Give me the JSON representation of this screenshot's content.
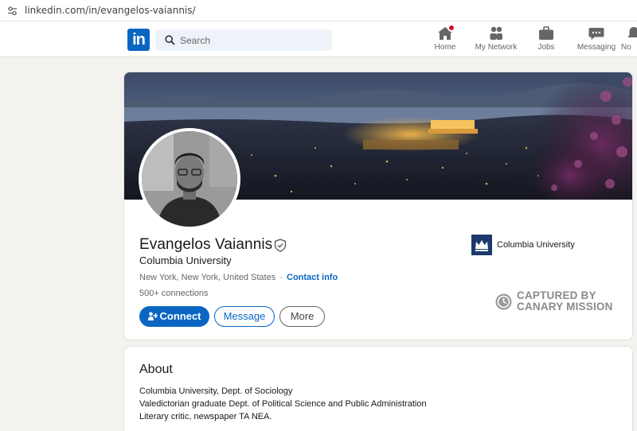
{
  "browser": {
    "url": "linkedin.com/in/evangelos-vaiannis/"
  },
  "nav": {
    "logo": "in",
    "search_placeholder": "Search",
    "items": [
      {
        "label": "Home",
        "icon": "home-icon"
      },
      {
        "label": "My Network",
        "icon": "network-icon"
      },
      {
        "label": "Jobs",
        "icon": "briefcase-icon"
      },
      {
        "label": "Messaging",
        "icon": "messaging-icon"
      },
      {
        "label": "No",
        "icon": "bell-icon"
      }
    ]
  },
  "profile": {
    "name": "Evangelos Vaiannis",
    "headline": "Columbia University",
    "location": "New York, New York, United States",
    "location_separator": "·",
    "contact_info": "Contact info",
    "connections": "500+ connections",
    "buttons": {
      "connect": "Connect",
      "message": "Message",
      "more": "More"
    },
    "education": {
      "school": "Columbia University"
    },
    "colors": {
      "accent": "#0a66c2",
      "crest": "#1b3a6b"
    }
  },
  "watermark": {
    "line1": "CAPTURED BY",
    "line2": "CANARY MISSION"
  },
  "about": {
    "title": "About",
    "lines": [
      "Columbia University, Dept. of Sociology",
      "Valedictorian graduate Dept. of Political Science and Public Administration",
      "Literary critic, newspaper TA NEA."
    ]
  }
}
